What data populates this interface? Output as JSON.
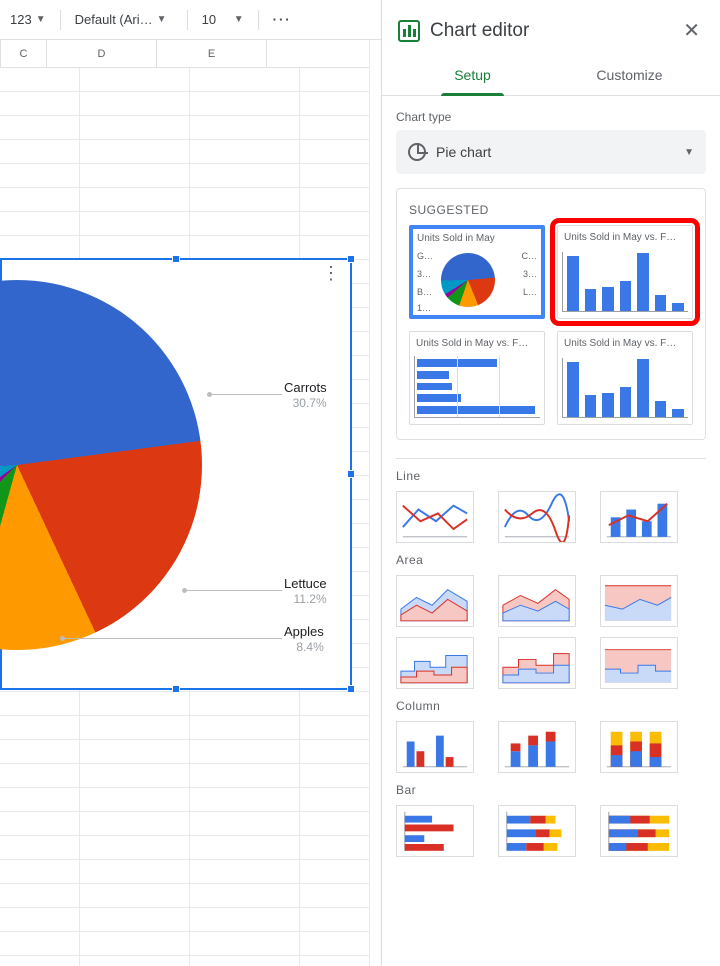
{
  "toolbar": {
    "format_number": "123",
    "font": "Default (Ari…",
    "font_size": "10",
    "more": "···",
    "collapse_glyph": "⌃"
  },
  "columns": [
    "C",
    "D",
    "E"
  ],
  "sheet_chart": {
    "labels": {
      "carrots": "Carrots",
      "carrots_pct": "30.7%",
      "lettuce": "Lettuce",
      "lettuce_pct": "11.2%",
      "apples": "Apples",
      "apples_pct": "8.4%"
    }
  },
  "editor": {
    "title": "Chart editor",
    "tabs": {
      "setup": "Setup",
      "customize": "Customize"
    },
    "chart_type_label": "Chart type",
    "chart_type_value": "Pie chart",
    "sections": {
      "suggested": "SUGGESTED",
      "line": "Line",
      "area": "Area",
      "column": "Column",
      "bar": "Bar"
    },
    "suggested_cards": {
      "pie": "Units Sold in May",
      "col1": "Units Sold in May vs. F…",
      "hbar": "Units Sold in May vs. F…",
      "col2": "Units Sold in May vs. F…"
    },
    "mini_legend": {
      "g": "G…",
      "c": "C…",
      "threea": "3…",
      "b": "B…",
      "threeb": "3…",
      "one": "1…",
      "l": "L…"
    }
  },
  "chart_data": {
    "type": "pie",
    "title": "Units Sold in May",
    "series": [
      {
        "name": "Carrots",
        "pct": 30.7,
        "color": "#3366cc"
      },
      {
        "name": "Lettuce",
        "pct": 11.2,
        "color": "#ff9900"
      },
      {
        "name": "Apples",
        "pct": 8.4,
        "color": "#109618"
      }
    ],
    "note": "Remaining slices visible but unlabeled in crop: red (~20.1%), purple (~2.5%), teal (~8.6%), and continuation of blue (~18.5%)."
  }
}
